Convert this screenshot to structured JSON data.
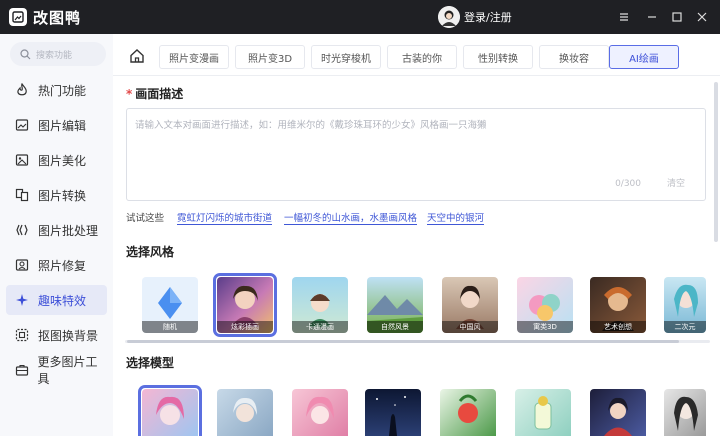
{
  "app": {
    "title": "改图鸭",
    "login": "登录/注册"
  },
  "sidebar": {
    "search_placeholder": "搜索功能",
    "items": [
      {
        "label": "热门功能",
        "icon": "flame-icon"
      },
      {
        "label": "图片编辑",
        "icon": "image-edit-icon"
      },
      {
        "label": "图片美化",
        "icon": "image-beautify-icon"
      },
      {
        "label": "图片转换",
        "icon": "convert-icon"
      },
      {
        "label": "图片批处理",
        "icon": "batch-icon"
      },
      {
        "label": "照片修复",
        "icon": "photo-repair-icon"
      },
      {
        "label": "趣味特效",
        "icon": "sparkle-icon"
      },
      {
        "label": "抠图换背景",
        "icon": "cutout-icon"
      },
      {
        "label": "更多图片工具",
        "icon": "toolbox-icon"
      }
    ],
    "active_index": 6
  },
  "tabs": [
    {
      "label": "照片变漫画"
    },
    {
      "label": "照片变3D"
    },
    {
      "label": "时光穿梭机"
    },
    {
      "label": "古装的你"
    },
    {
      "label": "性别转换"
    },
    {
      "label": "换妆容"
    },
    {
      "label": "AI绘画"
    }
  ],
  "active_tab": 6,
  "description": {
    "title": "画面描述",
    "required_mark": "*",
    "placeholder": "请输入文本对画面进行描述，如：用维米尔的《戴珍珠耳环的少女》风格画一只海獭",
    "counter": "0/300",
    "clear": "清空"
  },
  "try": {
    "label": "试试这些",
    "links": [
      "霓虹灯闪烁的城市街道",
      "一幅初冬的山水画，水墨画风格",
      "天空中的银河"
    ]
  },
  "styles": {
    "title": "选择风格",
    "items": [
      "随机",
      "炫彩插画",
      "卡通漫画",
      "自然风景",
      "中国风",
      "寓类3D",
      "艺术创想",
      "二次元"
    ],
    "selected_index": 1
  },
  "models": {
    "title": "选择模型",
    "selected_index": 0
  },
  "colors": {
    "accent": "#3d4fd8",
    "titlebar": "#1f2024",
    "link": "#3f57d6"
  }
}
